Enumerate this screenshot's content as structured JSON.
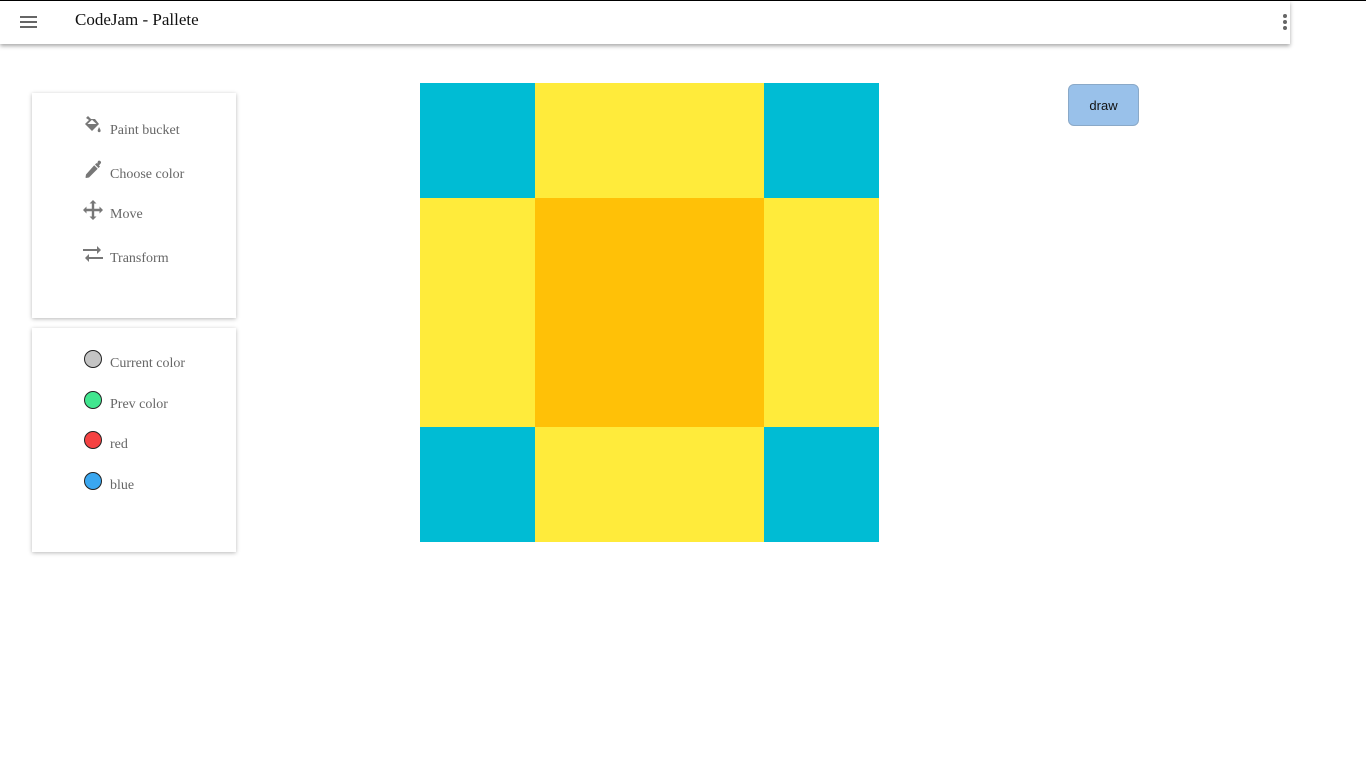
{
  "app": {
    "title": "CodeJam - Pallete"
  },
  "appbar": {
    "menu_icon": "hamburger-menu-icon",
    "more_icon": "more-vert-icon"
  },
  "tools": [
    {
      "label": "Paint bucket",
      "icon": "paint-bucket-icon"
    },
    {
      "label": "Choose color",
      "icon": "eyedropper-icon"
    },
    {
      "label": "Move",
      "icon": "move-icon"
    },
    {
      "label": "Transform",
      "icon": "swap-arrows-icon"
    }
  ],
  "colors": [
    {
      "label": "Current color",
      "color": "#c4c4c4"
    },
    {
      "label": "Prev color",
      "color": "#41e68f"
    },
    {
      "label": "red",
      "color": "#f44242"
    },
    {
      "label": "blue",
      "color": "#3aa7f0"
    }
  ],
  "canvas": {
    "colors": {
      "teal": "#00bcd4",
      "yellow": "#ffeb3b",
      "amber": "#ffc107"
    },
    "grid": [
      [
        "teal",
        "yellow",
        "yellow",
        "teal"
      ],
      [
        "yellow",
        "amber",
        "amber",
        "yellow"
      ],
      [
        "yellow",
        "amber",
        "amber",
        "yellow"
      ],
      [
        "teal",
        "yellow",
        "yellow",
        "teal"
      ]
    ]
  },
  "actions": {
    "draw_label": "draw",
    "draw_color": "#99c1ea"
  }
}
